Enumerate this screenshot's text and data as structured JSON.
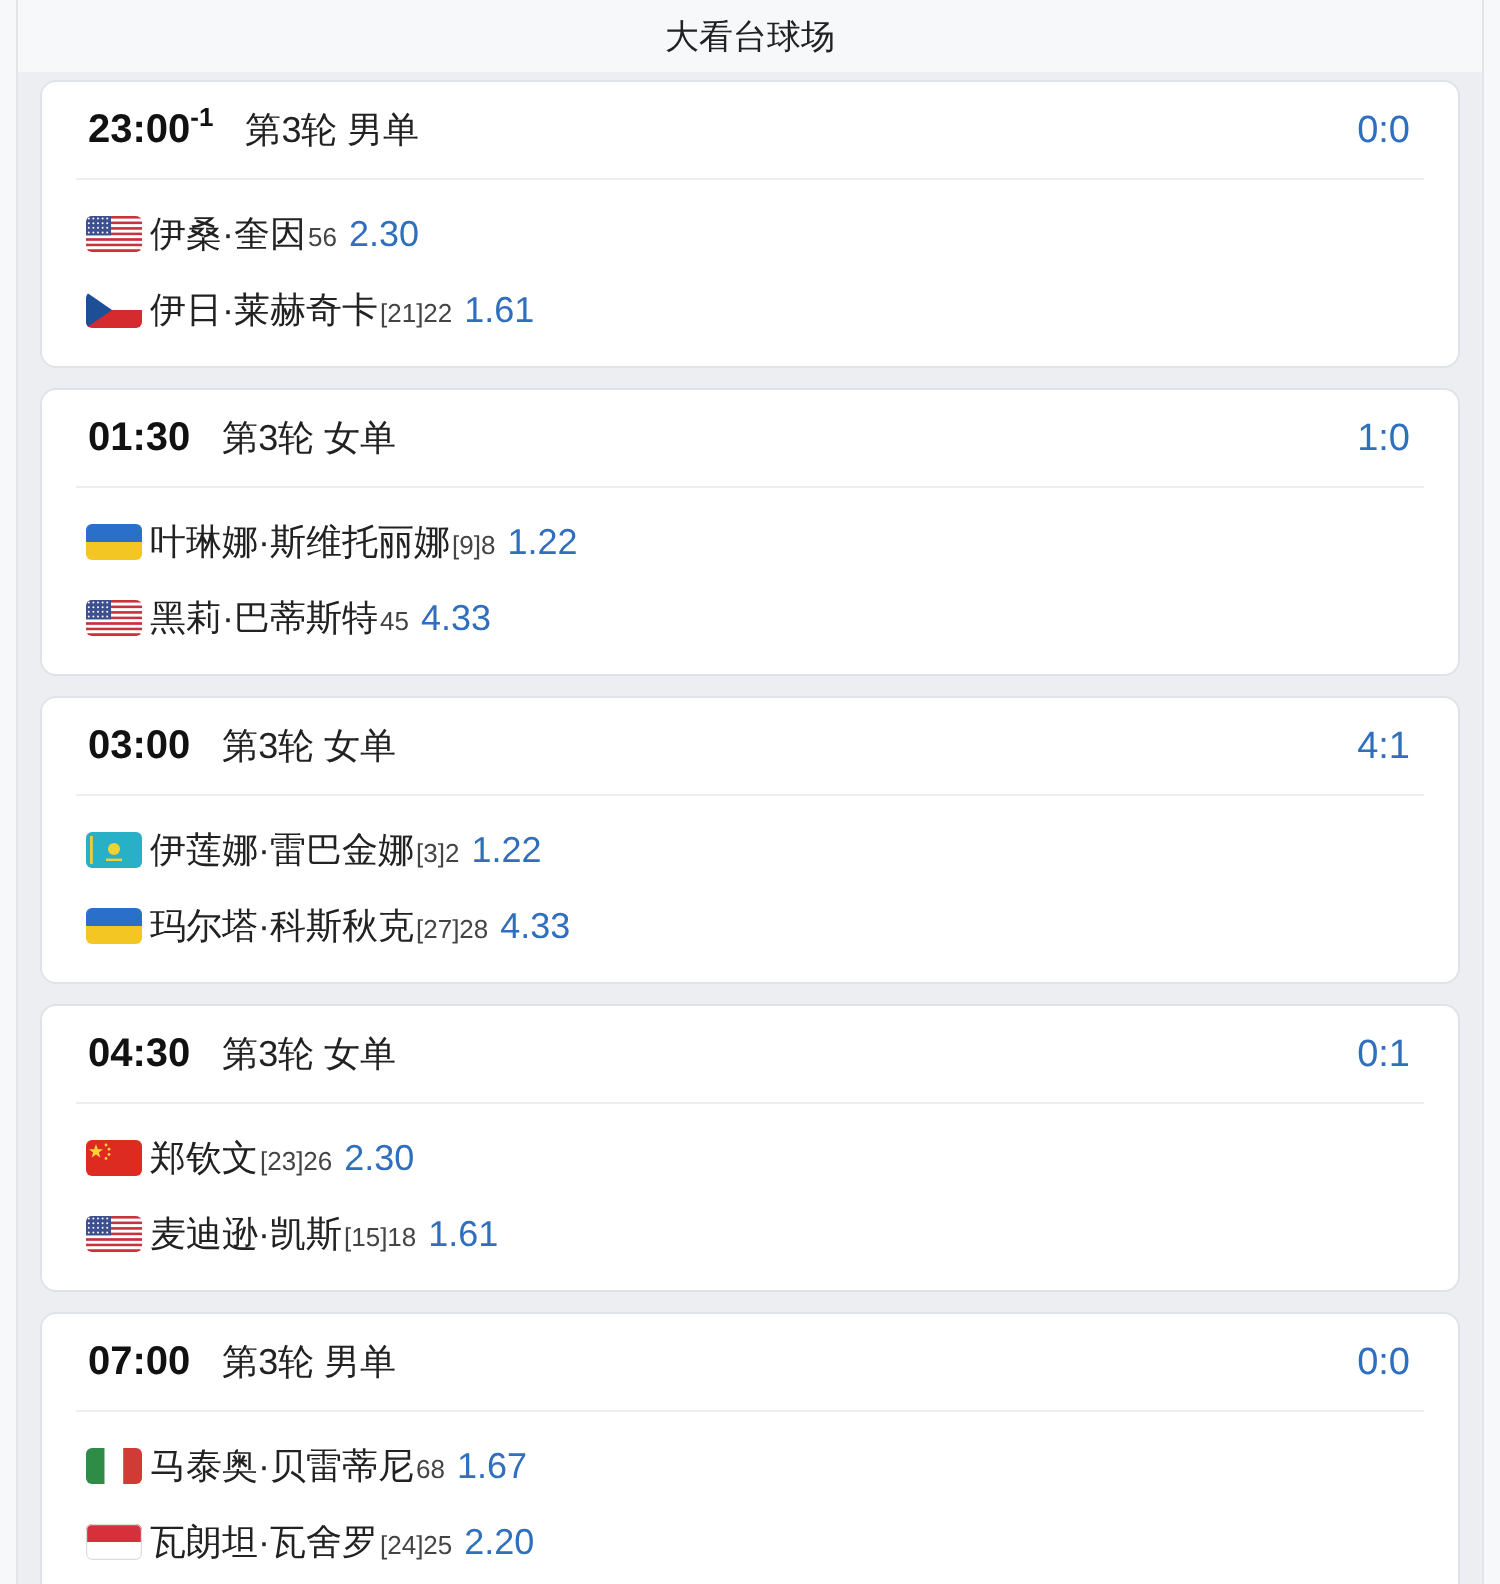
{
  "venue": {
    "title": "大看台球场"
  },
  "matches": [
    {
      "time": "23:00$^{-1}$",
      "round": "第3轮 男单",
      "score": "0:0",
      "players": [
        {
          "kind": "us",
          "name": "伊桑·奎因",
          "rank": "56",
          "odds": "2.30"
        },
        {
          "kind": "cz",
          "name": "伊日·莱赫奇卡",
          "rank": "[21]22",
          "odds": "1.61"
        }
      ]
    },
    {
      "time": "01:30",
      "round": "第3轮 女单",
      "score": "1:0",
      "players": [
        {
          "kind": "ua",
          "name": "叶琳娜·斯维托丽娜",
          "rank": "[9]8",
          "odds": "1.22"
        },
        {
          "kind": "us",
          "name": "黑莉·巴蒂斯特",
          "rank": "45",
          "odds": "4.33"
        }
      ]
    },
    {
      "time": "03:00",
      "round": "第3轮 女单",
      "score": "4:1",
      "players": [
        {
          "kind": "kz",
          "name": "伊莲娜·雷巴金娜",
          "rank": "[3]2",
          "odds": "1.22"
        },
        {
          "kind": "ua",
          "name": "玛尔塔·科斯秋克",
          "rank": "[27]28",
          "odds": "4.33"
        }
      ]
    },
    {
      "time": "04:30",
      "round": "第3轮 女单",
      "score": "0:1",
      "players": [
        {
          "kind": "cn",
          "name": "郑钦文",
          "rank": "[23]26",
          "odds": "2.30"
        },
        {
          "kind": "us",
          "name": "麦迪逊·凯斯",
          "rank": "[15]18",
          "odds": "1.61"
        }
      ]
    },
    {
      "time": "07:00",
      "round": "第3轮 男单",
      "score": "0:0",
      "players": [
        {
          "kind": "it",
          "name": "马泰奥·贝雷蒂尼",
          "rank": "68",
          "odds": "1.67"
        },
        {
          "kind": "mc",
          "name": "瓦朗坦·瓦舍罗",
          "rank": "[24]25",
          "odds": "2.20"
        }
      ]
    }
  ]
}
